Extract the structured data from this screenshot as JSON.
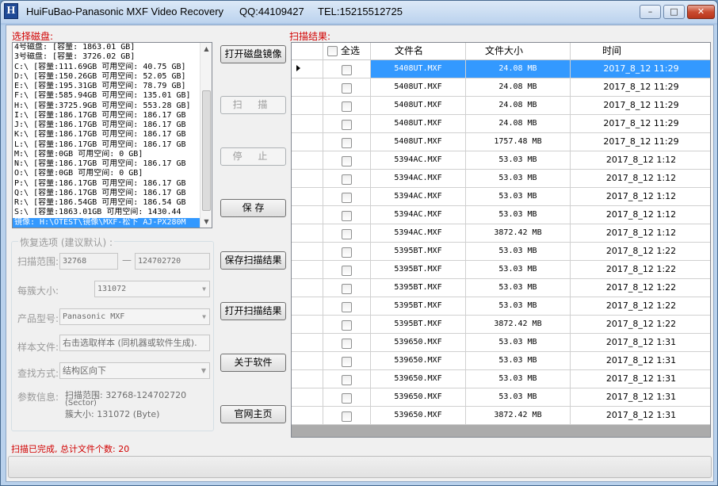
{
  "window": {
    "title": "HuiFuBao-Panasonic MXF Video Recovery",
    "qq": "QQ:44109427",
    "tel": "TEL:15215512725",
    "minimize": "–",
    "maximize": "□",
    "close": "✕",
    "icon_letter": "H"
  },
  "disks": {
    "label": "选择磁盘:",
    "items": [
      "4号磁盘: [容量: 1863.01 GB]",
      "3号磁盘: [容量: 3726.02 GB]",
      "C:\\ [容量:111.69GB 可用空间: 40.75 GB]",
      "D:\\ [容量:150.26GB 可用空间: 52.05 GB]",
      "E:\\ [容量:195.31GB 可用空间: 78.79 GB]",
      "F:\\ [容量:585.94GB 可用空间: 135.01 GB]",
      "H:\\ [容量:3725.9GB 可用空间: 553.28 GB]",
      "I:\\ [容量:186.17GB 可用空间: 186.17 GB",
      "J:\\ [容量:186.17GB 可用空间: 186.17 GB",
      "K:\\ [容量:186.17GB 可用空间: 186.17 GB",
      "L:\\ [容量:186.17GB 可用空间: 186.17 GB",
      "M:\\ [容量:0GB 可用空间: 0 GB]",
      "N:\\ [容量:186.17GB 可用空间: 186.17 GB",
      "O:\\ [容量:0GB 可用空间: 0 GB]",
      "P:\\ [容量:186.17GB 可用空间: 186.17 GB",
      "Q:\\ [容量:186.17GB 可用空间: 186.17 GB",
      "R:\\ [容量:186.54GB 可用空间: 186.54 GB",
      "S:\\ [容量:1863.01GB 可用空间: 1430.44",
      "镜像: H:\\OTEST\\镜像\\MXF-松下 AJ-PX280M"
    ]
  },
  "buttons": {
    "open_image": "打开磁盘镜像",
    "scan": "扫 描",
    "stop": "停 止",
    "save": "保 存",
    "save_results": "保存扫描结果",
    "open_results": "打开扫描结果",
    "about": "关于软件",
    "homepage": "官网主页"
  },
  "options": {
    "legend": "恢复选项 (建议默认) :",
    "scan_range_label": "扫描范围:",
    "scan_from": "32768",
    "range_dash": "—",
    "scan_to": "124702720",
    "cluster_label": "每簇大小:",
    "cluster_value": "131072",
    "model_label": "产品型号:",
    "model_value": "Panasonic MXF",
    "sample_label": "样本文件:",
    "sample_value": "右击选取样本 (同机器或软件生成).",
    "find_label": "查找方式:",
    "find_value": "结构区向下",
    "params_label": "参数信息:",
    "params_line1": "扫描范围: 32768-124702720",
    "params_line2": "(Sector)",
    "params_line3": "簇大小: 131072  (Byte)"
  },
  "results": {
    "label": "扫描结果:",
    "columns": {
      "select_all": "全选",
      "filename": "文件名",
      "size": "文件大小",
      "time": "时间"
    },
    "rows": [
      {
        "name": "5408UT.MXF",
        "size": "24.08 MB",
        "time": "2017_8_12 11:29"
      },
      {
        "name": "5408UT.MXF",
        "size": "24.08 MB",
        "time": "2017_8_12 11:29"
      },
      {
        "name": "5408UT.MXF",
        "size": "24.08 MB",
        "time": "2017_8_12 11:29"
      },
      {
        "name": "5408UT.MXF",
        "size": "24.08 MB",
        "time": "2017_8_12 11:29"
      },
      {
        "name": "5408UT.MXF",
        "size": "1757.48 MB",
        "time": "2017_8_12 11:29"
      },
      {
        "name": "5394AC.MXF",
        "size": "53.03 MB",
        "time": "2017_8_12 1:12"
      },
      {
        "name": "5394AC.MXF",
        "size": "53.03 MB",
        "time": "2017_8_12 1:12"
      },
      {
        "name": "5394AC.MXF",
        "size": "53.03 MB",
        "time": "2017_8_12 1:12"
      },
      {
        "name": "5394AC.MXF",
        "size": "53.03 MB",
        "time": "2017_8_12 1:12"
      },
      {
        "name": "5394AC.MXF",
        "size": "3872.42 MB",
        "time": "2017_8_12 1:12"
      },
      {
        "name": "5395BT.MXF",
        "size": "53.03 MB",
        "time": "2017_8_12 1:22"
      },
      {
        "name": "5395BT.MXF",
        "size": "53.03 MB",
        "time": "2017_8_12 1:22"
      },
      {
        "name": "5395BT.MXF",
        "size": "53.03 MB",
        "time": "2017_8_12 1:22"
      },
      {
        "name": "5395BT.MXF",
        "size": "53.03 MB",
        "time": "2017_8_12 1:22"
      },
      {
        "name": "5395BT.MXF",
        "size": "3872.42 MB",
        "time": "2017_8_12 1:22"
      },
      {
        "name": "539650.MXF",
        "size": "53.03 MB",
        "time": "2017_8_12 1:31"
      },
      {
        "name": "539650.MXF",
        "size": "53.03 MB",
        "time": "2017_8_12 1:31"
      },
      {
        "name": "539650.MXF",
        "size": "53.03 MB",
        "time": "2017_8_12 1:31"
      },
      {
        "name": "539650.MXF",
        "size": "53.03 MB",
        "time": "2017_8_12 1:31"
      },
      {
        "name": "539650.MXF",
        "size": "3872.42 MB",
        "time": "2017_8_12 1:31"
      }
    ]
  },
  "status": {
    "text": "扫描已完成, 总计文件个数: 20"
  },
  "colors": {
    "accent": "#d10000",
    "selection": "#3399ff"
  }
}
